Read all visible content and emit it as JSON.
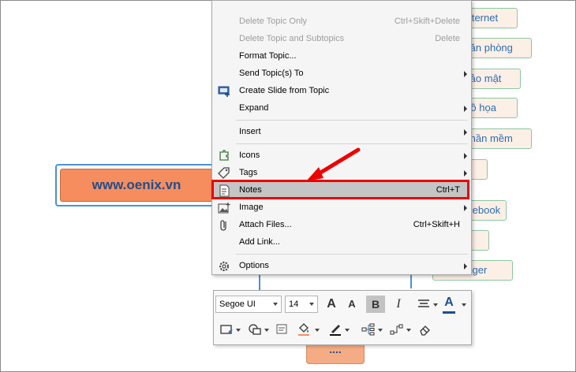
{
  "central_topic": {
    "label": "www.oenix.vn"
  },
  "topics": [
    {
      "label": "Internet"
    },
    {
      "label": "Văn phòng"
    },
    {
      "label": "Bảo mật"
    },
    {
      "label": "Đồ họa"
    },
    {
      "label": "Phần mềm"
    },
    {
      "label": ""
    },
    {
      "label": "Facebook"
    },
    {
      "label": ""
    },
    {
      "label": "Messenger"
    }
  ],
  "bottom_topic": {
    "label": "...."
  },
  "menu": {
    "items": [
      {
        "label": "Delete Topic Only",
        "shortcut": "Ctrl+Skift+Delete"
      },
      {
        "label": "Delete Topic and Subtopics",
        "shortcut": "Delete"
      },
      {
        "label": "Format Topic..."
      },
      {
        "label": "Send Topic(s) To"
      },
      {
        "label": "Create Slide from Topic"
      },
      {
        "label": "Expand"
      },
      {
        "label": "Insert"
      },
      {
        "label": "Icons"
      },
      {
        "label": "Tags"
      },
      {
        "label": "Notes",
        "shortcut": "Ctrl+T"
      },
      {
        "label": "Image"
      },
      {
        "label": "Attach Files...",
        "shortcut": "Ctrl+Skift+H"
      },
      {
        "label": "Add Link..."
      },
      {
        "label": "Options"
      }
    ]
  },
  "toolbar": {
    "font": "Segoe UI",
    "size": "14",
    "bold": "B",
    "italic": "I",
    "color_a": "A",
    "grow": "A",
    "shrink": "A"
  }
}
